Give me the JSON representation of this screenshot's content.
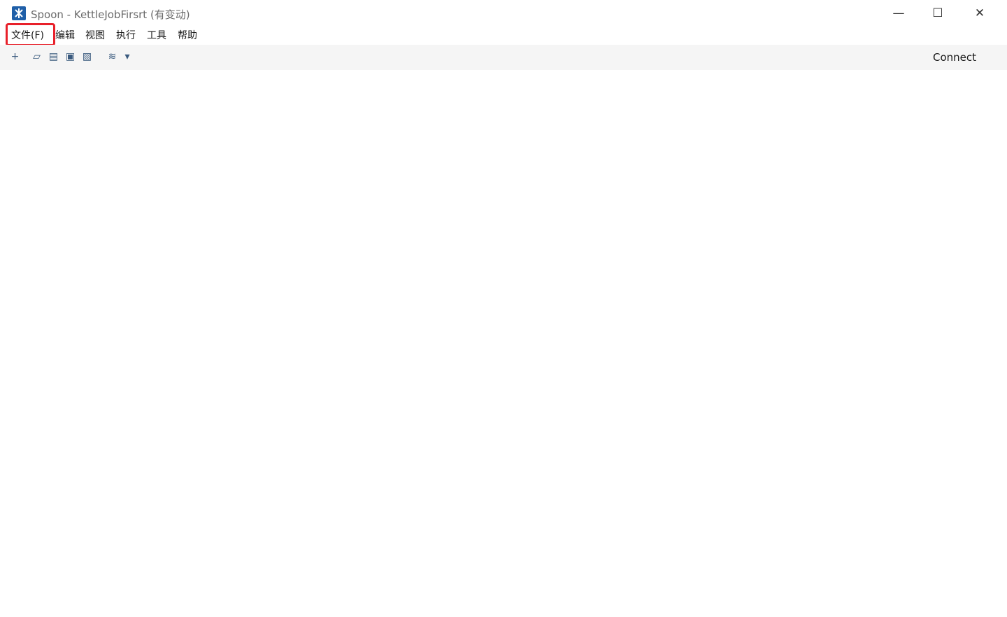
{
  "window": {
    "title": "Spoon - KettleJobFirsrt (有变动)",
    "minimize": "—",
    "maximize": "☐",
    "close": "✕"
  },
  "menubar": {
    "file": "文件(F)",
    "edit": "编辑",
    "view": "视图",
    "run": "执行",
    "tools": "工具",
    "help": "帮助"
  },
  "toolbar": {
    "connect": "Connect"
  }
}
